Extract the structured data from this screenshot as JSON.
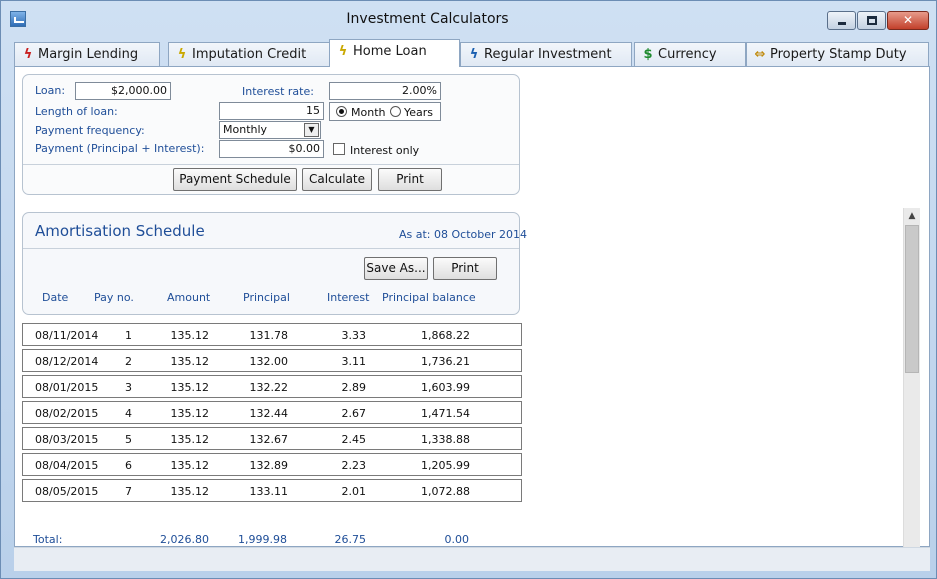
{
  "window": {
    "title": "Investment Calculators"
  },
  "tabs": [
    {
      "label": "Margin Lending",
      "icon": "bolt-red-icon"
    },
    {
      "label": "Imputation Credit",
      "icon": "bolt-yellow-icon"
    },
    {
      "label": "Home Loan",
      "icon": "bolt-yellow-icon",
      "active": true
    },
    {
      "label": "Regular Investment",
      "icon": "bolt-blue-icon"
    },
    {
      "label": "Currency",
      "icon": "dollar-icon"
    },
    {
      "label": "Property Stamp Duty",
      "icon": "arrows-icon"
    }
  ],
  "form": {
    "loan_label": "Loan:",
    "loan_value": "$2,000.00",
    "interest_label": "Interest rate:",
    "interest_value": "2.00%",
    "length_label": "Length of loan:",
    "length_value": "15",
    "period_month": "Month",
    "period_years": "Years",
    "period_selected": "Month",
    "freq_label": "Payment frequency:",
    "freq_value": "Monthly",
    "payment_label": "Payment (Principal +  Interest):",
    "payment_value": "$0.00",
    "interest_only_label": "Interest only",
    "interest_only_checked": false,
    "btn_schedule": "Payment Schedule",
    "btn_calculate": "Calculate",
    "btn_print": "Print"
  },
  "schedule": {
    "title": "Amortisation Schedule",
    "as_at": "As at: 08 October 2014",
    "btn_save": "Save As...",
    "btn_print": "Print",
    "columns": [
      "Date",
      "Pay no.",
      "Amount",
      "Principal",
      "Interest",
      "Principal balance"
    ],
    "rows": [
      [
        "08/11/2014",
        "1",
        "135.12",
        "131.78",
        "3.33",
        "1,868.22"
      ],
      [
        "08/12/2014",
        "2",
        "135.12",
        "132.00",
        "3.11",
        "1,736.21"
      ],
      [
        "08/01/2015",
        "3",
        "135.12",
        "132.22",
        "2.89",
        "1,603.99"
      ],
      [
        "08/02/2015",
        "4",
        "135.12",
        "132.44",
        "2.67",
        "1,471.54"
      ],
      [
        "08/03/2015",
        "5",
        "135.12",
        "132.67",
        "2.45",
        "1,338.88"
      ],
      [
        "08/04/2015",
        "6",
        "135.12",
        "132.89",
        "2.23",
        "1,205.99"
      ],
      [
        "08/05/2015",
        "7",
        "135.12",
        "133.11",
        "2.01",
        "1,072.88"
      ]
    ],
    "total": {
      "label": "Total:",
      "amount": "2,026.80",
      "principal": "1,999.98",
      "interest": "26.75",
      "balance": "0.00"
    }
  },
  "colors": {
    "label_blue": "#1f4e98",
    "window_frame": "#b9d0ea"
  }
}
